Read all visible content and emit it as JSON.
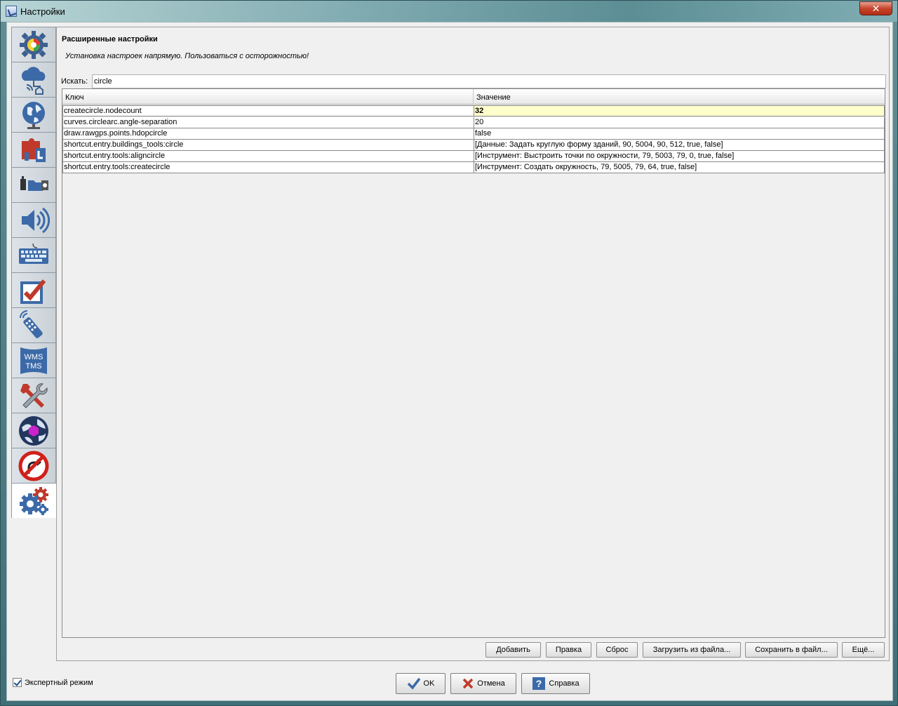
{
  "window": {
    "title": "Настройки",
    "close_glyph": "✕"
  },
  "sidebar": {
    "tabs": [
      {
        "icon": "display-settings-icon"
      },
      {
        "icon": "cloud-connection-icon"
      },
      {
        "icon": "globe-projection-icon"
      },
      {
        "icon": "plugin-puzzle-icon"
      },
      {
        "icon": "file-shortcuts-icon"
      },
      {
        "icon": "audio-speaker-icon"
      },
      {
        "icon": "keyboard-icon"
      },
      {
        "icon": "validator-checkbox-icon"
      },
      {
        "icon": "remote-control-icon"
      },
      {
        "icon": "wms-tms-icon",
        "text_line1": "WMS",
        "text_line2": "TMS"
      },
      {
        "icon": "tools-wrench-icon"
      },
      {
        "icon": "map-paint-styles-icon"
      },
      {
        "icon": "no-turn-restriction-icon"
      },
      {
        "icon": "advanced-gears-icon",
        "selected": true
      }
    ]
  },
  "panel": {
    "heading": "Расширенные настройки",
    "subheading": "Установка настроек напрямую. Пользоваться с осторожностью!",
    "search_label": "Искать:",
    "search_value": "circle",
    "columns": {
      "key": "Ключ",
      "value": "Значение"
    },
    "rows": [
      {
        "key": "createcircle.nodecount",
        "value": "32"
      },
      {
        "key": "curves.circlearc.angle-separation",
        "value": "20"
      },
      {
        "key": "draw.rawgps.points.hdopcircle",
        "value": "false"
      },
      {
        "key": "shortcut.entry.buildings_tools:circle",
        "value": "[Данные: Задать круглую форму зданий, 90, 5004, 90, 512, true, false]"
      },
      {
        "key": "shortcut.entry.tools:aligncircle",
        "value": "[Инструмент: Выстроить точки по окружности, 79, 5003, 79, 0, true, false]"
      },
      {
        "key": "shortcut.entry.tools:createcircle",
        "value": "[Инструмент: Создать окружность, 79, 5005, 79, 64, true, false]"
      }
    ],
    "buttons": {
      "add": "Добавить",
      "edit": "Правка",
      "reset": "Сброс",
      "load": "Загрузить из файла...",
      "save": "Сохранить в файл...",
      "more": "Ещё..."
    }
  },
  "footer": {
    "expert_mode_label": "Экспертный режим",
    "expert_mode_checked": true,
    "ok_label": "OK",
    "cancel_label": "Отмена",
    "help_label": "Справка"
  },
  "colors": {
    "highlight_row": "#ffffcc",
    "client_bg": "#f0f0f0",
    "close_button": "#c7452c"
  }
}
